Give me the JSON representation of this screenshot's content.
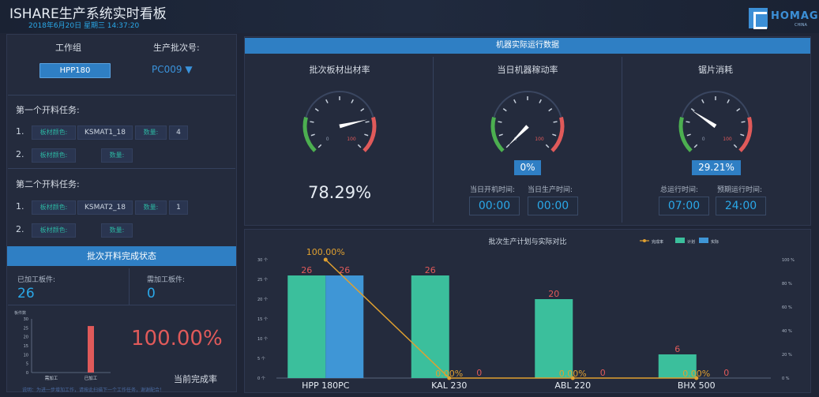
{
  "header": {
    "title": "ISHARE生产系统实时看板",
    "datetime": "2018年6月20日 星期三 14:37:20",
    "logo_text": "HOMAG",
    "logo_sub": "CHINA"
  },
  "left": {
    "workgroup_label": "工作组",
    "batch_label": "生产批次号:",
    "workgroup_value": "HPP180",
    "batch_value": "PC009 ▼",
    "task1": {
      "title": "第一个开料任务:",
      "rows": [
        {
          "idx": "1.",
          "color_label": "板材颜色:",
          "color_value": "KSMAT1_18",
          "qty_label": "数量:",
          "qty_value": "4"
        },
        {
          "idx": "2.",
          "color_label": "板材颜色:",
          "color_value": "",
          "qty_label": "数量:",
          "qty_value": ""
        }
      ]
    },
    "task2": {
      "title": "第二个开料任务:",
      "rows": [
        {
          "idx": "1.",
          "color_label": "板材颜色:",
          "color_value": "KSMAT2_18",
          "qty_label": "数量:",
          "qty_value": "1"
        },
        {
          "idx": "2.",
          "color_label": "板材颜色:",
          "color_value": "",
          "qty_label": "数量:",
          "qty_value": ""
        }
      ]
    },
    "status_title": "批次开料完成状态",
    "processed_label": "已加工板件:",
    "processed_value": "26",
    "to_process_label": "需加工板件:",
    "to_process_value": "0",
    "completion_rate": "100.00%",
    "completion_label": "当前完成率",
    "footnote": "说明：为进一步增加工作，请按此扫描下一个工作任务，谢谢配合！"
  },
  "mini_chart": {
    "type": "bar",
    "ylabel": "板件数",
    "categories": [
      "需加工",
      "已加工"
    ],
    "values": [
      0,
      26
    ],
    "ylim": [
      0,
      30
    ],
    "yticks": [
      "0",
      "5",
      "10",
      "15",
      "20",
      "25",
      "30"
    ],
    "color": "#e05a5a"
  },
  "machine": {
    "section_title": "机器实际运行数据",
    "gauges": [
      {
        "title": "批次板材出材率",
        "value_text": "78.29%",
        "value": 78.29,
        "min_label": "0",
        "max_label": "100"
      },
      {
        "title": "当日机器稼动率",
        "value_text": "0%",
        "value": 0,
        "min_label": "0",
        "max_label": "100",
        "time1_label": "当日开机时间:",
        "time1": "00:00",
        "time2_label": "当日生产时间:",
        "time2": "00:00"
      },
      {
        "title": "锯片消耗",
        "value_text": "29.21%",
        "value": 29.21,
        "min_label": "0",
        "max_label": "100",
        "time1_label": "总运行时间:",
        "time1": "07:00",
        "time2_label": "预期运行时间:",
        "time2": "24:00"
      }
    ]
  },
  "chart_data": {
    "type": "bar",
    "title": "批次生产计划与实际对比",
    "categories": [
      "HPP 180PC",
      "KAL 230",
      "ABL 220",
      "BHX 500"
    ],
    "series": [
      {
        "name": "计划",
        "type": "bar",
        "color": "#3bbf9c",
        "values": [
          26,
          26,
          20,
          6
        ]
      },
      {
        "name": "实际",
        "type": "bar",
        "color": "#3f96d6",
        "values": [
          26,
          0,
          0,
          0
        ]
      },
      {
        "name": "完成率",
        "type": "line",
        "color": "#e0a030",
        "values": [
          100,
          0,
          0,
          0
        ],
        "labels": [
          "100.00%",
          "0.00%",
          "0.00%",
          "0.00%"
        ]
      }
    ],
    "bar_labels": {
      "plan": [
        "26",
        "26",
        "20",
        "6"
      ],
      "actual": [
        "26",
        "0",
        "0",
        "0"
      ]
    },
    "ylim_left": [
      0,
      30
    ],
    "yticks_left": [
      "0 个",
      "5 个",
      "10 个",
      "15 个",
      "20 个",
      "25 个",
      "30 个"
    ],
    "ylim_right": [
      0,
      100
    ],
    "yticks_right": [
      "0 %",
      "20 %",
      "40 %",
      "60 %",
      "80 %",
      "100 %"
    ],
    "legend": [
      "完成率",
      "计划",
      "实际"
    ],
    "legend_position": "top-right"
  }
}
